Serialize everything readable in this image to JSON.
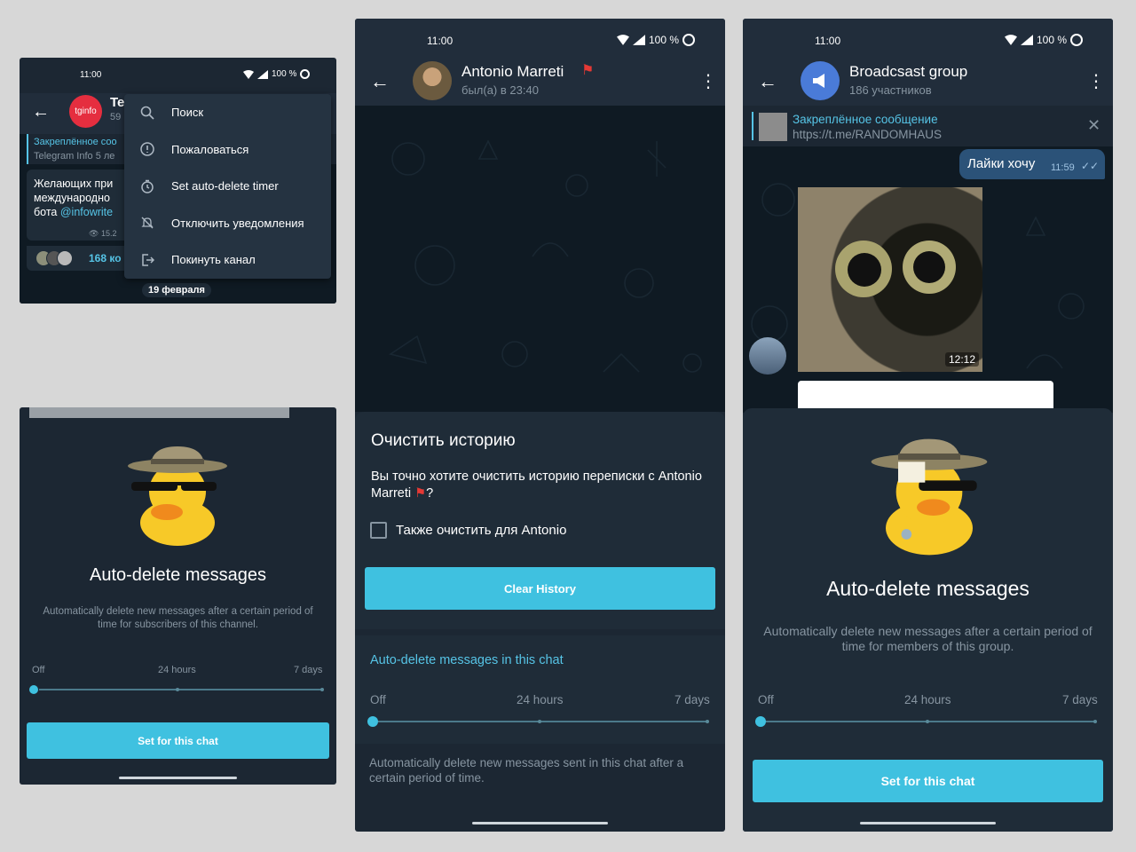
{
  "status": {
    "time": "11:00",
    "battery": "100 %",
    "network": "LTE"
  },
  "panel1": {
    "avatar_text": "tginfo",
    "channel_title_fragment": "Te",
    "channel_sub_fragment": "59",
    "pinned_label": "Закреплённое соо",
    "pinned_sub": "Telegram Info 5 ле",
    "message_lines": [
      "Желающих при",
      "международно",
      "бота "
    ],
    "message_link": "@infowrite",
    "views": "15.2",
    "comments": "168 ко",
    "date_chip": "19 февраля",
    "menu": [
      {
        "label": "Поиск",
        "icon": "search-icon"
      },
      {
        "label": "Пожаловаться",
        "icon": "report-icon"
      },
      {
        "label": "Set auto-delete timer",
        "icon": "timer-icon"
      },
      {
        "label": "Отключить уведомления",
        "icon": "mute-icon"
      },
      {
        "label": "Покинуть канал",
        "icon": "leave-icon"
      }
    ]
  },
  "panel2": {
    "title": "Auto-delete messages",
    "description": "Automatically delete new messages after a certain period of time for subscribers of this channel.",
    "slider": {
      "off": "Off",
      "mid": "24 hours",
      "max": "7 days",
      "selected": "Off"
    },
    "button": "Set for this chat"
  },
  "panel3": {
    "contact_name": "Antonio Marreti",
    "contact_status": "был(а) в 23:40",
    "dialog_title": "Очистить историю",
    "dialog_text": "Вы точно хотите очистить историю переписки с Antonio Marreti",
    "dialog_text_end": "?",
    "checkbox_label": "Также очистить для Antonio",
    "checkbox_checked": false,
    "clear_button": "Clear History",
    "autodelete_header": "Auto-delete messages in this chat",
    "slider": {
      "off": "Off",
      "mid": "24 hours",
      "max": "7 days",
      "selected": "Off"
    },
    "footer_text": "Automatically delete new messages sent in this chat after a certain period of time."
  },
  "panel4": {
    "group_name": "Broadcsast group",
    "members": "186 участников",
    "pinned_label": "Закреплённое сообщение",
    "pinned_link": "https://t.me/RANDOMHAUS",
    "out_message": "Лайки хочу",
    "out_time": "11:59",
    "video_duration": "12:12",
    "title": "Auto-delete messages",
    "description": "Automatically delete new messages after a certain period of time for members of this group.",
    "slider": {
      "off": "Off",
      "mid": "24 hours",
      "max": "7 days",
      "selected": "Off"
    },
    "button": "Set for this chat"
  },
  "colors": {
    "accent": "#3fc1e0",
    "panel_bg": "#1c2733",
    "chat_bg": "#0f1a23",
    "link": "#56c4e6"
  }
}
